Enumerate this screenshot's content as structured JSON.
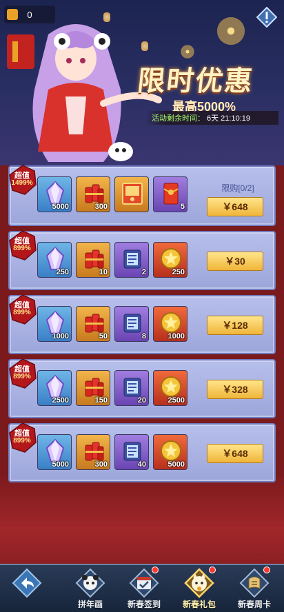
{
  "banner": {
    "counter": "0",
    "title": "限时优惠",
    "subtitle": "最高5000%",
    "timer_label": "活动剩余时间：",
    "timer_value": "6天  21:10:19"
  },
  "packs": [
    {
      "badge_top": "超值",
      "badge_pct": "1499%",
      "limit": "限购[0/2]",
      "price": "￥648",
      "items": [
        {
          "icon": "crystal-icon",
          "color": "blue",
          "qty": "5000"
        },
        {
          "icon": "firecracker-icon",
          "color": "orange",
          "qty": "300"
        },
        {
          "icon": "card-pack-icon",
          "color": "orange",
          "qty": ""
        },
        {
          "icon": "red-envelope-icon",
          "color": "purple",
          "qty": "5"
        }
      ]
    },
    {
      "badge_top": "超值",
      "badge_pct": "899%",
      "price": "￥30",
      "items": [
        {
          "icon": "crystal-icon",
          "color": "blue",
          "qty": "250"
        },
        {
          "icon": "firecracker-icon",
          "color": "orange",
          "qty": "10"
        },
        {
          "icon": "scroll-ticket-icon",
          "color": "purple",
          "qty": "2"
        },
        {
          "icon": "gold-medal-icon",
          "color": "red",
          "qty": "250"
        }
      ]
    },
    {
      "badge_top": "超值",
      "badge_pct": "899%",
      "price": "￥128",
      "items": [
        {
          "icon": "crystal-icon",
          "color": "blue",
          "qty": "1000"
        },
        {
          "icon": "firecracker-icon",
          "color": "orange",
          "qty": "50"
        },
        {
          "icon": "scroll-ticket-icon",
          "color": "purple",
          "qty": "8"
        },
        {
          "icon": "gold-medal-icon",
          "color": "red",
          "qty": "1000"
        }
      ]
    },
    {
      "badge_top": "超值",
      "badge_pct": "899%",
      "price": "￥328",
      "items": [
        {
          "icon": "crystal-icon",
          "color": "blue",
          "qty": "2500"
        },
        {
          "icon": "firecracker-icon",
          "color": "orange",
          "qty": "150"
        },
        {
          "icon": "scroll-ticket-icon",
          "color": "purple",
          "qty": "20"
        },
        {
          "icon": "gold-medal-icon",
          "color": "red",
          "qty": "2500"
        }
      ]
    },
    {
      "badge_top": "超值",
      "badge_pct": "899%",
      "price": "￥648",
      "items": [
        {
          "icon": "crystal-icon",
          "color": "blue",
          "qty": "5000"
        },
        {
          "icon": "firecracker-icon",
          "color": "orange",
          "qty": "300"
        },
        {
          "icon": "scroll-ticket-icon",
          "color": "purple",
          "qty": "40"
        },
        {
          "icon": "gold-medal-icon",
          "color": "red",
          "qty": "5000"
        }
      ]
    }
  ],
  "nav": [
    {
      "label": "拼年画",
      "icon": "panda-face-icon",
      "dot": false
    },
    {
      "label": "新春签到",
      "icon": "calendar-check-icon",
      "dot": true
    },
    {
      "label": "新春礼包",
      "icon": "lucky-cat-icon",
      "dot": true,
      "active": true
    },
    {
      "label": "新春周卡",
      "icon": "card-icon",
      "dot": true
    }
  ],
  "colors": {
    "accent": "#f0b53a",
    "card": "#a8b0e0",
    "background": "#7a1a1c",
    "timer": "#a8ff6a"
  }
}
